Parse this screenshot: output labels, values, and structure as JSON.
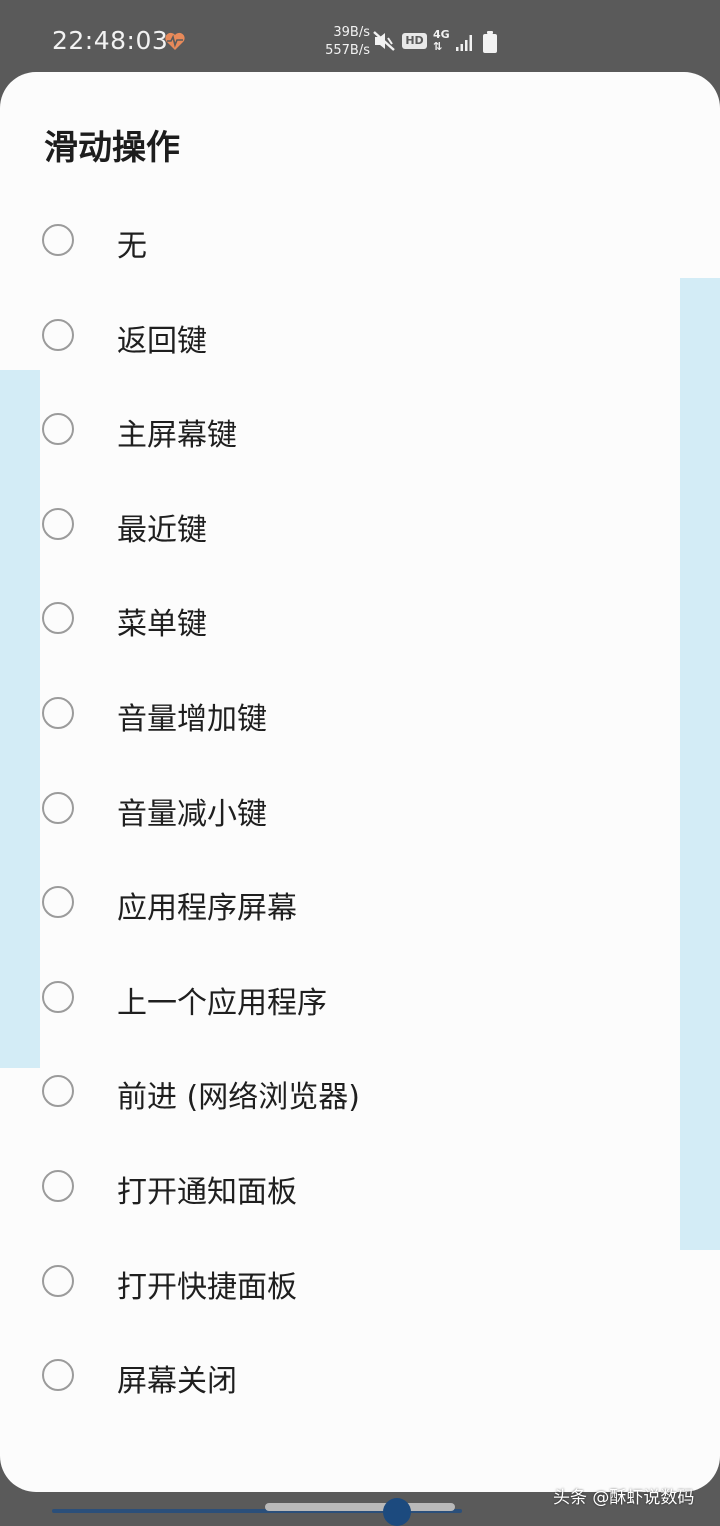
{
  "status_bar": {
    "time": "22:48:03",
    "net_up": "39B/s",
    "net_down": "557B/s",
    "hd": "HD",
    "network": "4G",
    "icons": [
      "heart-rate-icon",
      "mute-icon",
      "signal-icon",
      "battery-icon"
    ]
  },
  "dialog": {
    "title": "滑动操作",
    "options": [
      {
        "label": "无",
        "selected": false
      },
      {
        "label": "返回键",
        "selected": false
      },
      {
        "label": "主屏幕键",
        "selected": false
      },
      {
        "label": "最近键",
        "selected": false
      },
      {
        "label": "菜单键",
        "selected": false
      },
      {
        "label": "音量增加键",
        "selected": false
      },
      {
        "label": "音量减小键",
        "selected": false
      },
      {
        "label": "应用程序屏幕",
        "selected": false
      },
      {
        "label": "上一个应用程序",
        "selected": false
      },
      {
        "label": "前进 (网络浏览器)",
        "selected": false
      },
      {
        "label": "打开通知面板",
        "selected": false
      },
      {
        "label": "打开快捷面板",
        "selected": false
      },
      {
        "label": "屏幕关闭",
        "selected": false
      }
    ]
  },
  "watermark": "头条 @酥虾说数码",
  "colors": {
    "accent_highlight": "#d3ecf6",
    "sheet_background": "#fcfcfc",
    "status_bar_background": "#5a5a5a",
    "radio_border": "#9b9b9b",
    "heart": "#e88a5a"
  }
}
